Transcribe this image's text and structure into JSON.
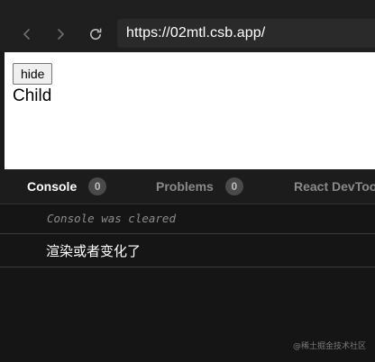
{
  "browser": {
    "url": "https://02mtl.csb.app/",
    "icons": {
      "back": "chevron-left-icon",
      "forward": "chevron-right-icon",
      "reload": "reload-icon"
    }
  },
  "preview": {
    "hide_button_label": "hide",
    "child_text": "Child"
  },
  "devtools": {
    "tabs": [
      {
        "label": "Console",
        "badge": "0",
        "active": true
      },
      {
        "label": "Problems",
        "badge": "0",
        "active": false
      },
      {
        "label": "React DevTools",
        "active": false
      }
    ],
    "console": {
      "cleared_message": "Console was cleared",
      "logs": [
        "渲染或者变化了"
      ]
    }
  },
  "watermark": "@稀土掘金技术社区",
  "colors": {
    "background": "#151515",
    "toolbar": "#1f1f1f",
    "address_bar": "#2a2a2a",
    "badge": "#4a4a4a",
    "active_tab_text": "#ffffff",
    "inactive_tab_text": "#8a8a8a"
  }
}
